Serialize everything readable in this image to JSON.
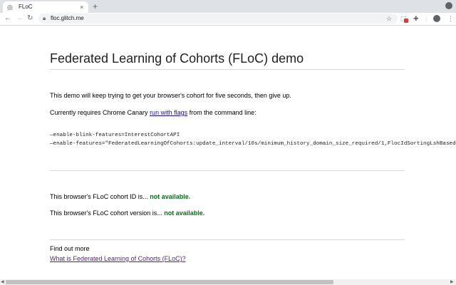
{
  "browser": {
    "tab_title": "FLoC",
    "tab_close": "×",
    "new_tab": "+",
    "url": "floc.glitch.me",
    "icons": {
      "favicon": "glitch-favicon-icon",
      "back": "back-arrow-icon",
      "forward": "forward-arrow-icon",
      "reload": "reload-icon",
      "lock": "lock-icon",
      "star": "star-icon",
      "extension": "extension-icon",
      "puzzle": "puzzle-icon",
      "profile": "profile-icon",
      "menu": "kebab-menu-icon"
    }
  },
  "page": {
    "title": "Federated Learning of Cohorts (FLoC) demo",
    "intro": "This demo will keep trying to get your browser's cohort for five seconds, then give up.",
    "requires_before": "Currently requires Chrome Canary ",
    "requires_link": "run with flags",
    "requires_after": " from the command line:",
    "cmd_line_1": "—enable-blink-features=InterestCohortAPI",
    "cmd_line_2": "—enable-features=\"FederatedLearningOfCohorts:update_interval/10s/minimum_history_domain_size_required/1,FlocIdSortingLshBasedComputation,Inter",
    "cohort_id_label": "This browser's FLoC cohort ID is... ",
    "cohort_id_value": "not available.",
    "cohort_version_label": "This browser's FLoC cohort version is... ",
    "cohort_version_value": "not available.",
    "find_out_more": "Find out more",
    "find_out_more_link": "What is Federated Learning of Cohorts (FLoC)?"
  },
  "colors": {
    "status_green": "#0a6b1a",
    "link_blue": "#1a0dab",
    "visited_purple": "#551a8b",
    "tabstrip_gray": "#dee1e6"
  }
}
